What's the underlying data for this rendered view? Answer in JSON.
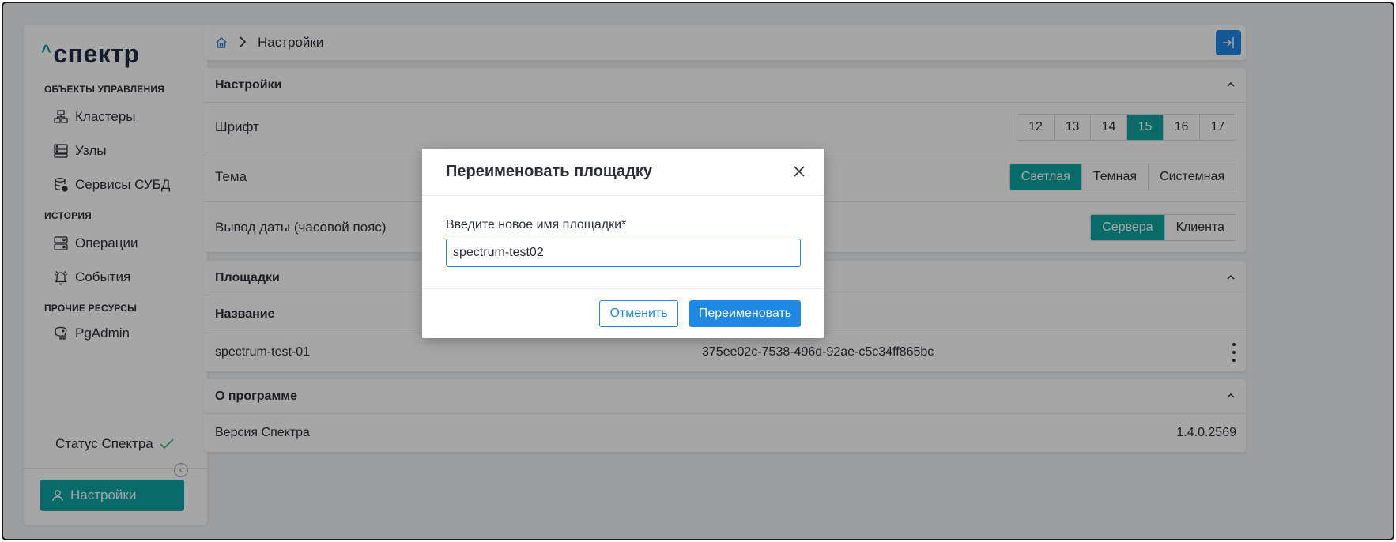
{
  "sidebar": {
    "logo": "спектр",
    "sections": [
      {
        "title": "ОБЪЕКТЫ УПРАВЛЕНИЯ"
      },
      {
        "title": "ИСТОРИЯ"
      },
      {
        "title": "ПРОЧИЕ РЕСУРСЫ"
      }
    ],
    "items": [
      {
        "label": "Кластеры",
        "icon": "cluster-icon"
      },
      {
        "label": "Узлы",
        "icon": "server-icon"
      },
      {
        "label": "Сервисы СУБД",
        "icon": "database-icon"
      },
      {
        "label": "Операции",
        "icon": "operations-icon"
      },
      {
        "label": "События",
        "icon": "bell-icon"
      },
      {
        "label": "PgAdmin",
        "icon": "elephant-icon"
      }
    ],
    "status_label": "Статус Спектра",
    "settings_label": "Настройки"
  },
  "topbar": {
    "breadcrumb": "Настройки"
  },
  "settings_panel": {
    "title": "Настройки",
    "font_label": "Шрифт",
    "font_options": [
      "12",
      "13",
      "14",
      "15",
      "16",
      "17"
    ],
    "font_selected": "15",
    "theme_label": "Тема",
    "theme_options": [
      "Светлая",
      "Темная",
      "Системная"
    ],
    "theme_selected": "Светлая",
    "date_label": "Вывод даты (часовой пояс)",
    "date_options": [
      "Сервера",
      "Клиента"
    ],
    "date_selected": "Сервера"
  },
  "sites_panel": {
    "title": "Площадки",
    "col_name": "Название",
    "rows": [
      {
        "name": "spectrum-test-01",
        "id": "375ee02c-7538-496d-92ae-c5c34ff865bc"
      }
    ]
  },
  "about_panel": {
    "title": "О программе",
    "version_label": "Версия Спектра",
    "version_value": "1.4.0.2569"
  },
  "modal": {
    "title": "Переименовать площадку",
    "field_label": "Введите новое имя площадки*",
    "field_value": "spectrum-test02",
    "cancel_label": "Отменить",
    "confirm_label": "Переименовать"
  },
  "colors": {
    "accent_teal": "#0fa3a3",
    "primary_blue": "#1e88e5"
  }
}
